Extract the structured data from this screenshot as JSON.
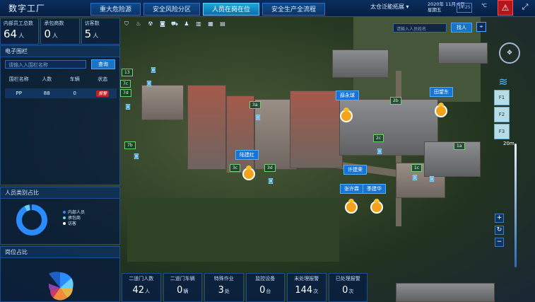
{
  "app": {
    "title": "数字工厂"
  },
  "tabs": [
    {
      "label": "重大危险源",
      "active": false
    },
    {
      "label": "安全风险分区",
      "active": false
    },
    {
      "label": "人员在岗在位",
      "active": true
    },
    {
      "label": "安全生产全流程",
      "active": false
    }
  ],
  "header": {
    "company": "太仓泛能拓展",
    "date_line1": "2020年 11月 6日",
    "date_line2": "星期五",
    "clock": "14:25",
    "temp_unit": "℃"
  },
  "stats": [
    {
      "label": "内部员工总数",
      "value": "64",
      "unit": "人"
    },
    {
      "label": "承包商数",
      "value": "0",
      "unit": "人"
    },
    {
      "label": "访客数",
      "value": "5",
      "unit": "人"
    }
  ],
  "fence": {
    "title": "电子围栏",
    "search_placeholder": "请输入入围栏名称",
    "query_label": "查询",
    "columns": [
      "围栏名称",
      "人数",
      "车辆",
      "状态"
    ],
    "rows": [
      {
        "name": "PP",
        "people": "88",
        "vehicles": "0",
        "status": "报警"
      }
    ]
  },
  "person_type": {
    "title": "人员类别占比",
    "legend": [
      {
        "label": "内部人员",
        "color": "#2b8cff"
      },
      {
        "label": "承包商",
        "color": "#62d1ff"
      },
      {
        "label": "访客",
        "color": "#ffffff"
      }
    ]
  },
  "post": {
    "title": "岗位占比"
  },
  "person_search": {
    "placeholder": "请输入人员姓名",
    "button": "找人"
  },
  "floors": [
    "F1",
    "F2",
    "F3"
  ],
  "scale": "20m",
  "bottom": [
    {
      "label": "二道门人数",
      "value": "42",
      "unit": "人"
    },
    {
      "label": "二道门车辆",
      "value": "0",
      "unit": "辆"
    },
    {
      "label": "特殊作业",
      "value": "3",
      "unit": "处"
    },
    {
      "label": "监控设备",
      "value": "0",
      "unit": "台"
    },
    {
      "label": "未处理报警",
      "value": "144",
      "unit": "次"
    },
    {
      "label": "已处理报警",
      "value": "0",
      "unit": "次"
    }
  ],
  "map": {
    "areas": [
      "13",
      "7c",
      "7d",
      "3a",
      "2b",
      "2c",
      "7b",
      "3c",
      "3d",
      "1c",
      "1a"
    ],
    "people": [
      "薛永球",
      "田望东",
      "陆建红",
      "许建荣",
      "张许霖",
      "季建华"
    ]
  }
}
